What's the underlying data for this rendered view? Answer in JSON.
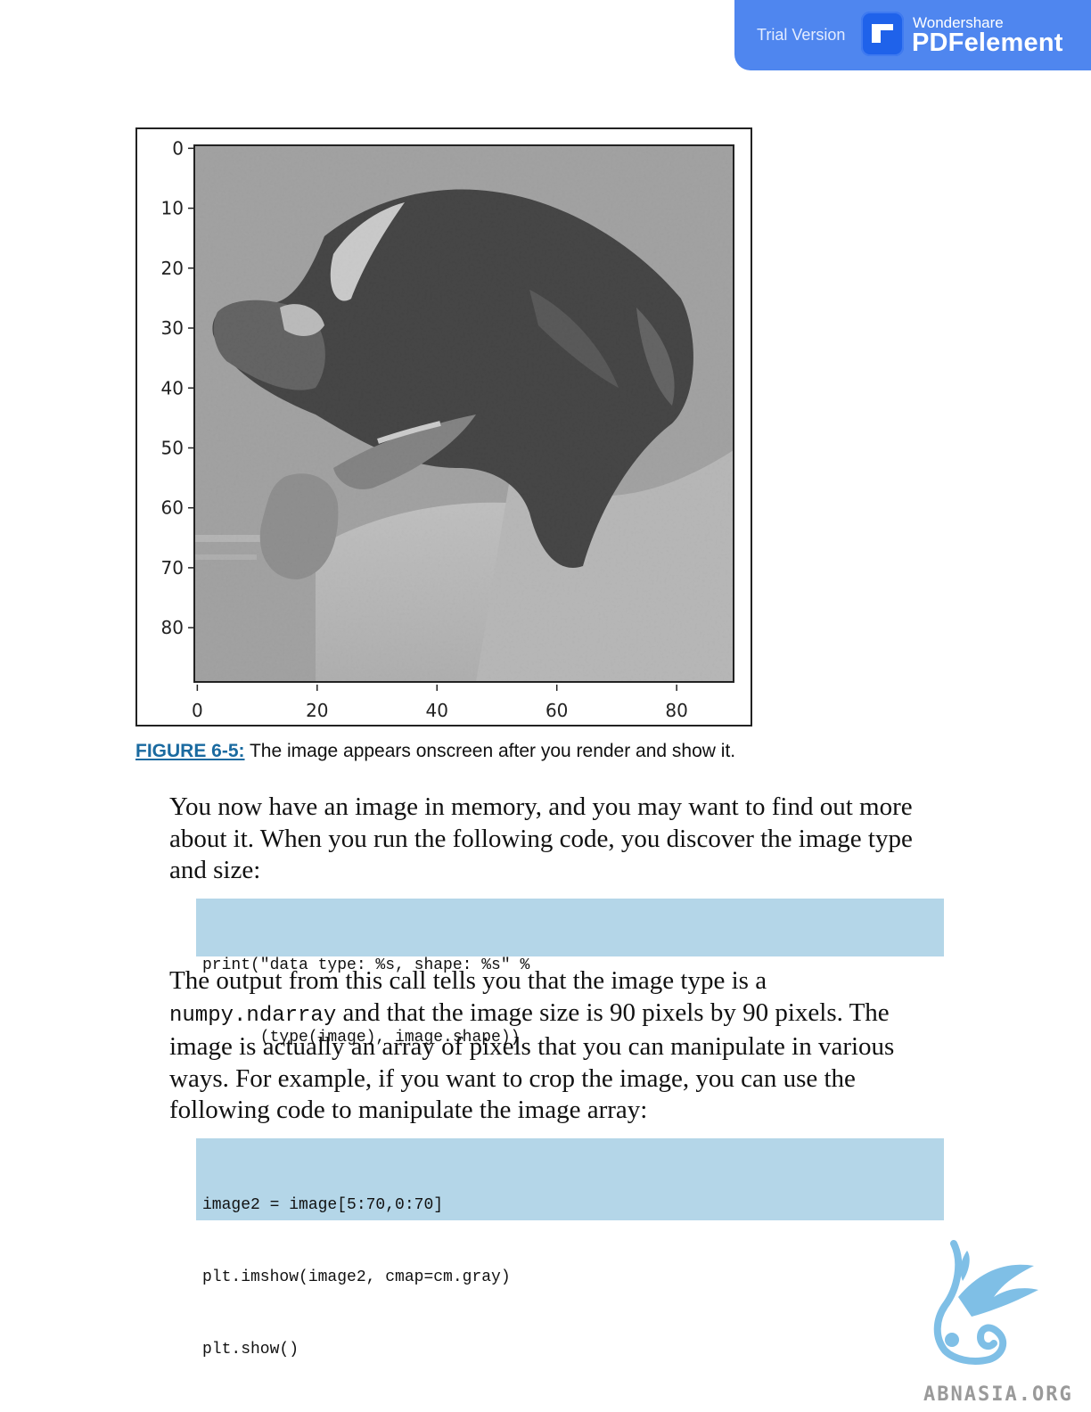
{
  "banner": {
    "trial_label": "Trial Version",
    "brand_small": "Wondershare",
    "brand_big": "PDFelement",
    "color": "#4f86ef",
    "icon": "pdfelement-logo-icon"
  },
  "figure": {
    "y_ticks": [
      "0",
      "10",
      "20",
      "30",
      "40",
      "50",
      "60",
      "70",
      "80"
    ],
    "x_ticks": [
      "0",
      "20",
      "40",
      "60",
      "80"
    ],
    "caption_label": "FIGURE 6-5:",
    "caption_text": " The image appears onscreen after you render and show it."
  },
  "para1": "You now have an image in memory, and you may want to find out more about it. When you run the following code, you discover the image type and size:",
  "code1": [
    "print(\"data type: %s, shape: %s\" %",
    "      (type(image), image.shape))"
  ],
  "para2": {
    "line1": "The output from this call tells you that the image type is a",
    "code": "numpy.ndarray",
    "rest": " and that the image size is 90 pixels by 90 pixels. The image is actually an array of pixels that you can manipulate in various ways. For example, if you want to crop the image, you can use the following code to manipulate the image array:"
  },
  "code2": [
    "image2 = image[5:70,0:70]",
    "plt.imshow(image2, cmap=cm.gray)",
    "plt.show()"
  ],
  "watermark": {
    "text": "ABNASIA.ORG",
    "icon": "griffin-logo-icon",
    "color": "#7fbfe6"
  }
}
